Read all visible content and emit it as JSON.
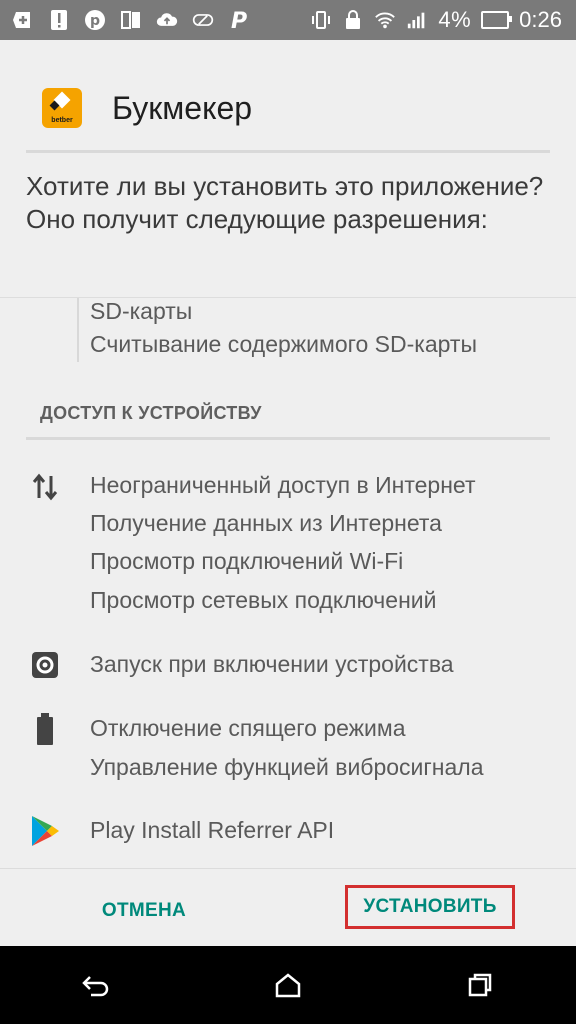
{
  "status_bar": {
    "left_icons": [
      "add-icon",
      "alert-icon",
      "pinterest-icon",
      "book-icon",
      "cloud-upload-icon",
      "link-icon",
      "p-icon"
    ],
    "right_icons": [
      "vibrate-icon",
      "lock-icon",
      "wifi-icon",
      "signal-icon"
    ],
    "battery_text": "4%",
    "time": "0:26"
  },
  "header": {
    "app_icon_brand": "betber",
    "app_name": "Букмекер"
  },
  "question": "Хотите ли вы установить это приложение? Оно получит следующие разрешения:",
  "storage_permissions": [
    "SD-карты",
    "Считывание содержимого SD-карты"
  ],
  "section": {
    "title": "ДОСТУП К УСТРОЙСТВУ"
  },
  "network_permissions": [
    "Неограниченный доступ в Интернет",
    "Получение данных из Интернета",
    "Просмотр подключений Wi-Fi",
    "Просмотр сетевых подключений"
  ],
  "startup_permissions": [
    "Запуск при включении устройства"
  ],
  "power_permissions": [
    "Отключение спящего режима",
    "Управление функцией вибросигнала"
  ],
  "play_permissions": [
    "Play Install Referrer API"
  ],
  "buttons": {
    "cancel": "ОТМЕНА",
    "install": "УСТАНОВИТЬ"
  },
  "colors": {
    "accent": "#00897b",
    "highlight": "#d32f2f",
    "status_bar": "#7a7a7a",
    "app_icon": "#f5a300"
  },
  "nav_bar": [
    "back-icon",
    "home-icon",
    "recents-icon"
  ]
}
